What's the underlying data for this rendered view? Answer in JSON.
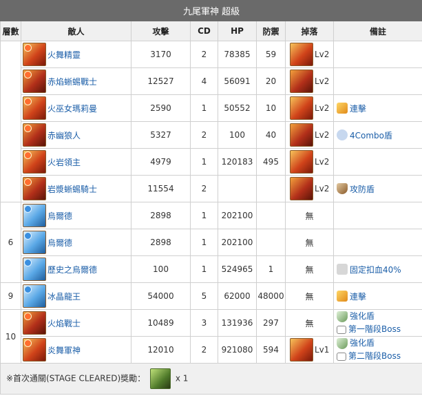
{
  "title": "九尾軍神 超級",
  "headers": [
    "層數",
    "敵人",
    "攻擊",
    "CD",
    "HP",
    "防禦",
    "掉落",
    "備註"
  ],
  "rows": [
    {
      "name": "火舞精靈",
      "atk": "3170",
      "cd": "2",
      "hp": "78385",
      "def": "59",
      "drop": "Lv2",
      "notes": []
    },
    {
      "name": "赤焰蜥蜴戰士",
      "atk": "12527",
      "cd": "4",
      "hp": "56091",
      "def": "20",
      "drop": "Lv2",
      "notes": []
    },
    {
      "name": "火巫女瑪莉曼",
      "atk": "2590",
      "cd": "1",
      "hp": "50552",
      "def": "10",
      "drop": "Lv2",
      "notes": [
        {
          "icon": "combo-x2-icon",
          "text": "連擊"
        }
      ]
    },
    {
      "name": "赤幽狼人",
      "atk": "5327",
      "cd": "2",
      "hp": "100",
      "def": "40",
      "drop": "Lv2",
      "notes": [
        {
          "icon": "combo-4-icon",
          "text": "4Combo盾"
        }
      ]
    },
    {
      "name": "火岩領主",
      "atk": "4979",
      "cd": "1",
      "hp": "120183",
      "def": "495",
      "drop": "Lv2",
      "notes": []
    },
    {
      "name": "岩漿蜥蜴騎士",
      "atk": "11554",
      "cd": "2",
      "hp": "",
      "def": "",
      "drop": "Lv2",
      "notes": [
        {
          "icon": "shield-icon",
          "text": "攻防盾"
        }
      ]
    },
    {
      "name": "烏爾德",
      "atk": "2898",
      "cd": "1",
      "hp": "202100",
      "def": "",
      "drop": "無",
      "notes": []
    },
    {
      "name": "烏爾德",
      "atk": "2898",
      "cd": "1",
      "hp": "202100",
      "def": "",
      "drop": "無",
      "notes": []
    },
    {
      "name": "歷史之烏爾德",
      "atk": "100",
      "cd": "1",
      "hp": "524965",
      "def": "1",
      "drop": "無",
      "notes": [
        {
          "icon": "fixed-damage-icon",
          "text": "固定扣血40%"
        }
      ]
    },
    {
      "name": "冰晶龍王",
      "atk": "54000",
      "cd": "5",
      "hp": "62000",
      "def": "48000",
      "drop": "無",
      "notes": [
        {
          "icon": "combo-x2-icon",
          "text": "連擊"
        }
      ]
    },
    {
      "name": "火焰戰士",
      "atk": "10489",
      "cd": "3",
      "hp": "131936",
      "def": "297",
      "drop": "無",
      "notes": [
        {
          "icon": "buff-shield-icon",
          "text": "強化盾"
        },
        {
          "icon": "boss-icon",
          "text": "第一階段Boss"
        }
      ]
    },
    {
      "name": "炎舞軍神",
      "atk": "12010",
      "cd": "2",
      "hp": "921080",
      "def": "594",
      "drop": "Lv1",
      "notes": [
        {
          "icon": "buff-shield-icon",
          "text": "強化盾"
        },
        {
          "icon": "boss-icon",
          "text": "第二階段Boss"
        }
      ]
    }
  ],
  "floors": {
    "f1": "",
    "f6": "6",
    "f9": "9",
    "f10": "10"
  },
  "footer": {
    "label": "※首次通關(STAGE CLEARED)獎勵：",
    "count": "x 1"
  },
  "colors": {
    "header_bg": "#6a6a6a",
    "link": "#1b5ea8"
  }
}
